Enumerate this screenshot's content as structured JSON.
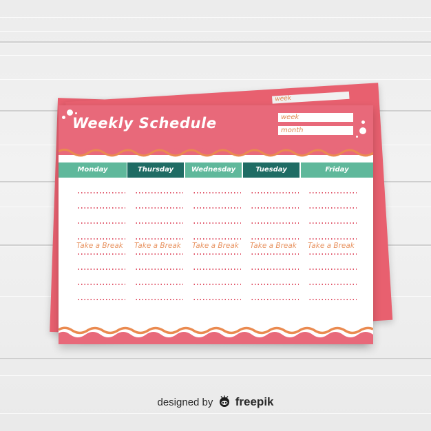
{
  "header": {
    "title": "Weekly Schedule",
    "fields": [
      {
        "label": "week"
      },
      {
        "label": "month"
      }
    ],
    "back_card_field": "week"
  },
  "days": [
    {
      "label": "Monday",
      "style": "light"
    },
    {
      "label": "Thursday",
      "style": "dark"
    },
    {
      "label": "Wednesday",
      "style": "light"
    },
    {
      "label": "Tuesday",
      "style": "dark"
    },
    {
      "label": "Friday",
      "style": "light"
    }
  ],
  "break_label": "Take a Break",
  "slots_before_break": 4,
  "slots_after_break": 4,
  "colors": {
    "header_pink": "#e8697a",
    "teal_light": "#5fb89b",
    "teal_dark": "#1f6c64",
    "wave_orange": "#ea8a50",
    "dots_red": "#e0566a",
    "break_orange": "#e89462"
  },
  "credit": {
    "prefix": "designed by",
    "brand": "freepik",
    "logo_icon": "freepik-logo-icon"
  }
}
